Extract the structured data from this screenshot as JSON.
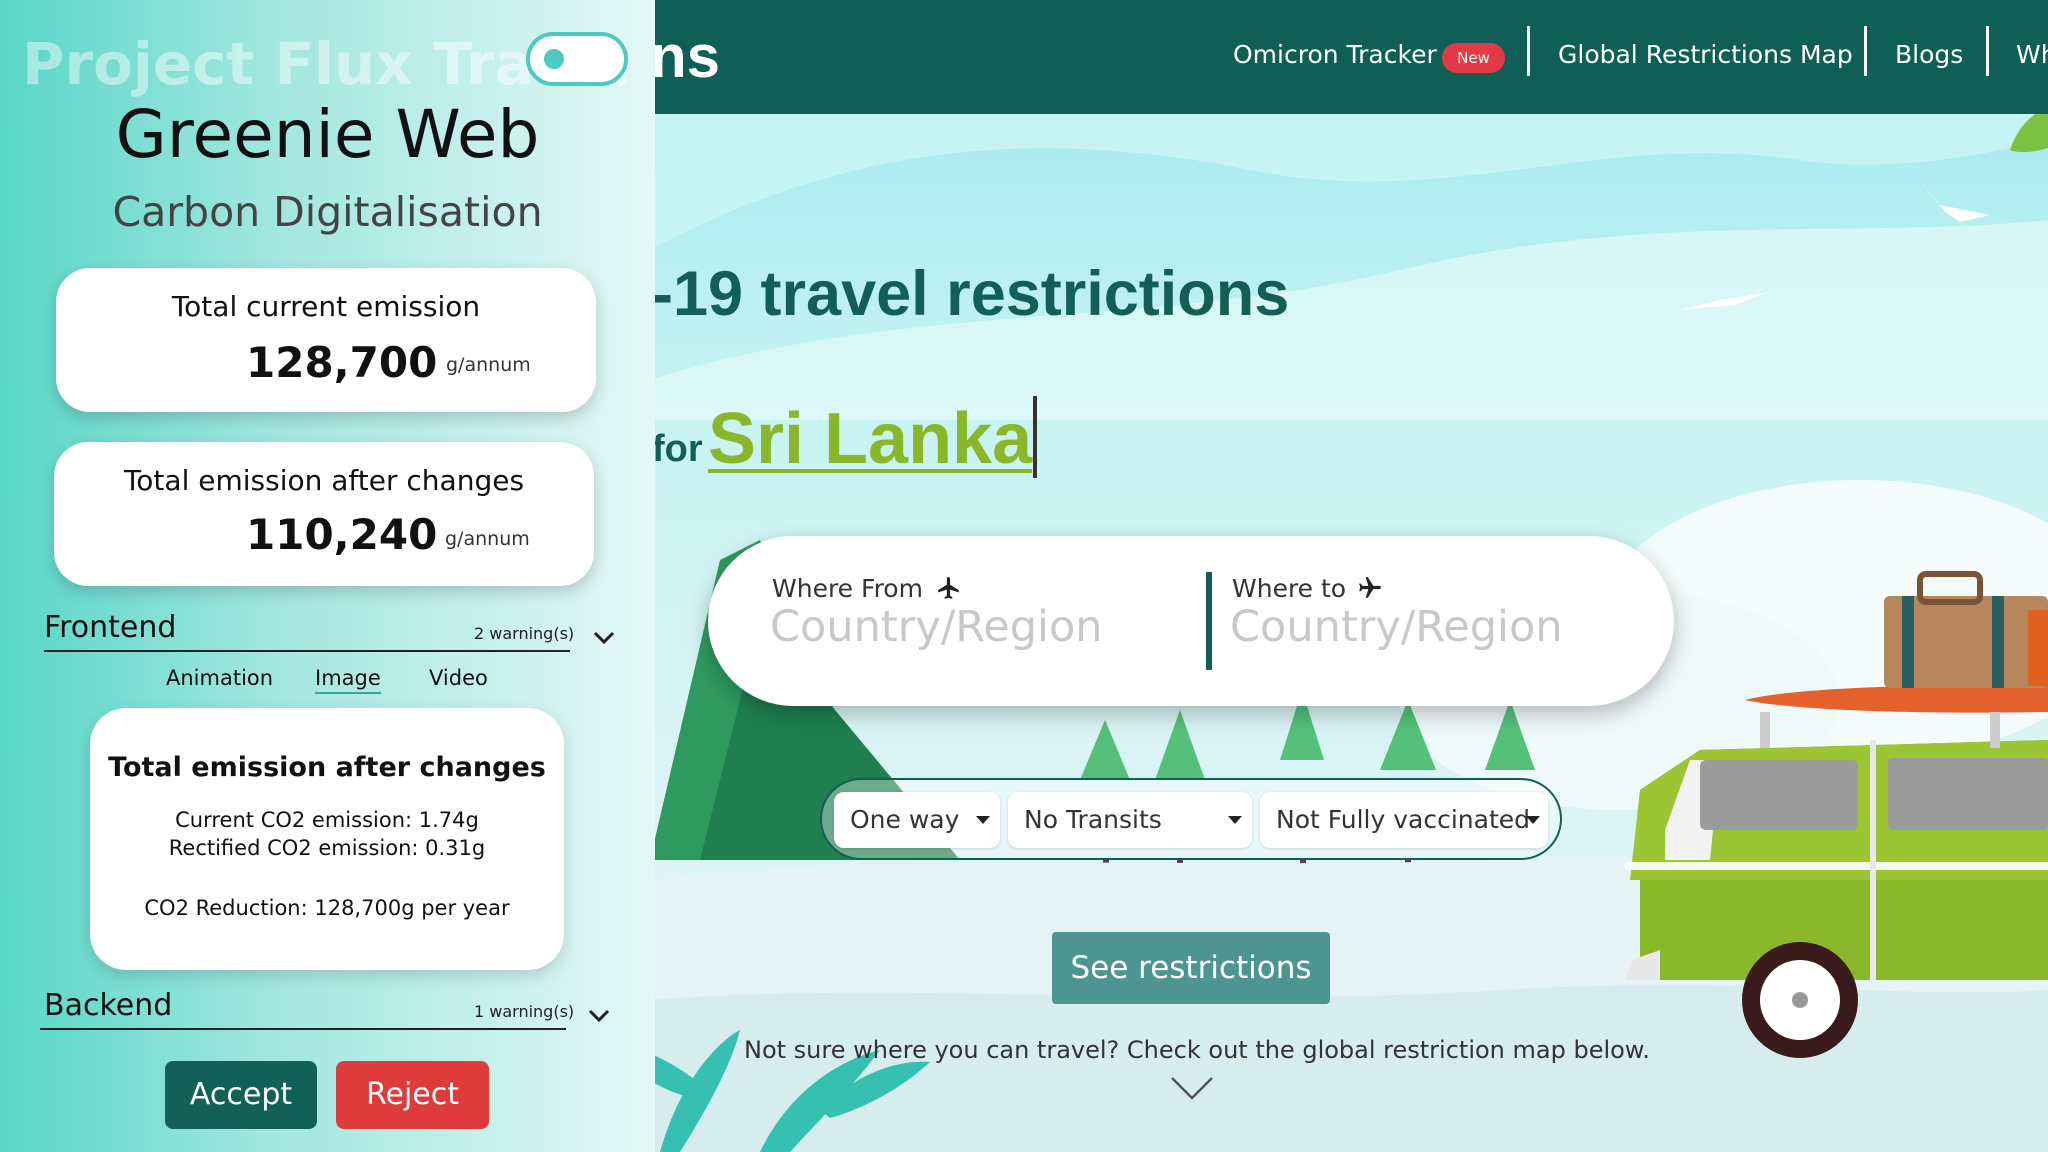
{
  "site": {
    "logo_fragment": "ns",
    "nav": {
      "omicron": "Omicron Tracker",
      "badge": "New",
      "global_map": "Global Restrictions Map",
      "blogs": "Blogs",
      "truncated": "Wh"
    },
    "hero": {
      "title": "-19 travel restrictions",
      "for_label": "for",
      "country": "Sri Lanka"
    },
    "search": {
      "from_label": "Where From",
      "from_placeholder": "Country/Region",
      "to_label": "Where to",
      "to_placeholder": "Country/Region"
    },
    "options": {
      "trip": "One way",
      "transits": "No Transits",
      "vaccination": "Not Fully vaccinated"
    },
    "see_button": "See restrictions",
    "hint": "Not sure where you can travel? Check out the global restriction map below.",
    "colors": {
      "nav_bg": "#0f5f57",
      "accent": "#8ab72a",
      "badge": "#e53945",
      "button": "#4e9490"
    }
  },
  "panel": {
    "ghost_logo": "Project Flux Travel",
    "title": "Greenie Web",
    "subtitle": "Carbon Digitalisation",
    "current": {
      "label": "Total current emission",
      "value": "128,700",
      "unit": "g/annum"
    },
    "after": {
      "label": "Total emission after changes",
      "value": "110,240",
      "unit": "g/annum"
    },
    "frontend": {
      "label": "Frontend",
      "warnings": "2 warning(s)",
      "tabs": [
        "Animation",
        "Image",
        "Video"
      ],
      "active_tab": "Image",
      "detail": {
        "heading": "Total emission after changes",
        "current": "Current CO2 emission: 1.74g",
        "rectified": "Rectified CO2 emission: 0.31g",
        "reduction": "CO2 Reduction: 128,700g per year"
      }
    },
    "backend": {
      "label": "Backend",
      "warnings": "1 warning(s)"
    },
    "accept": "Accept",
    "reject": "Reject",
    "colors": {
      "accept": "#126159",
      "reject": "#df3a3c",
      "toggle": "#4ec9c0"
    }
  }
}
